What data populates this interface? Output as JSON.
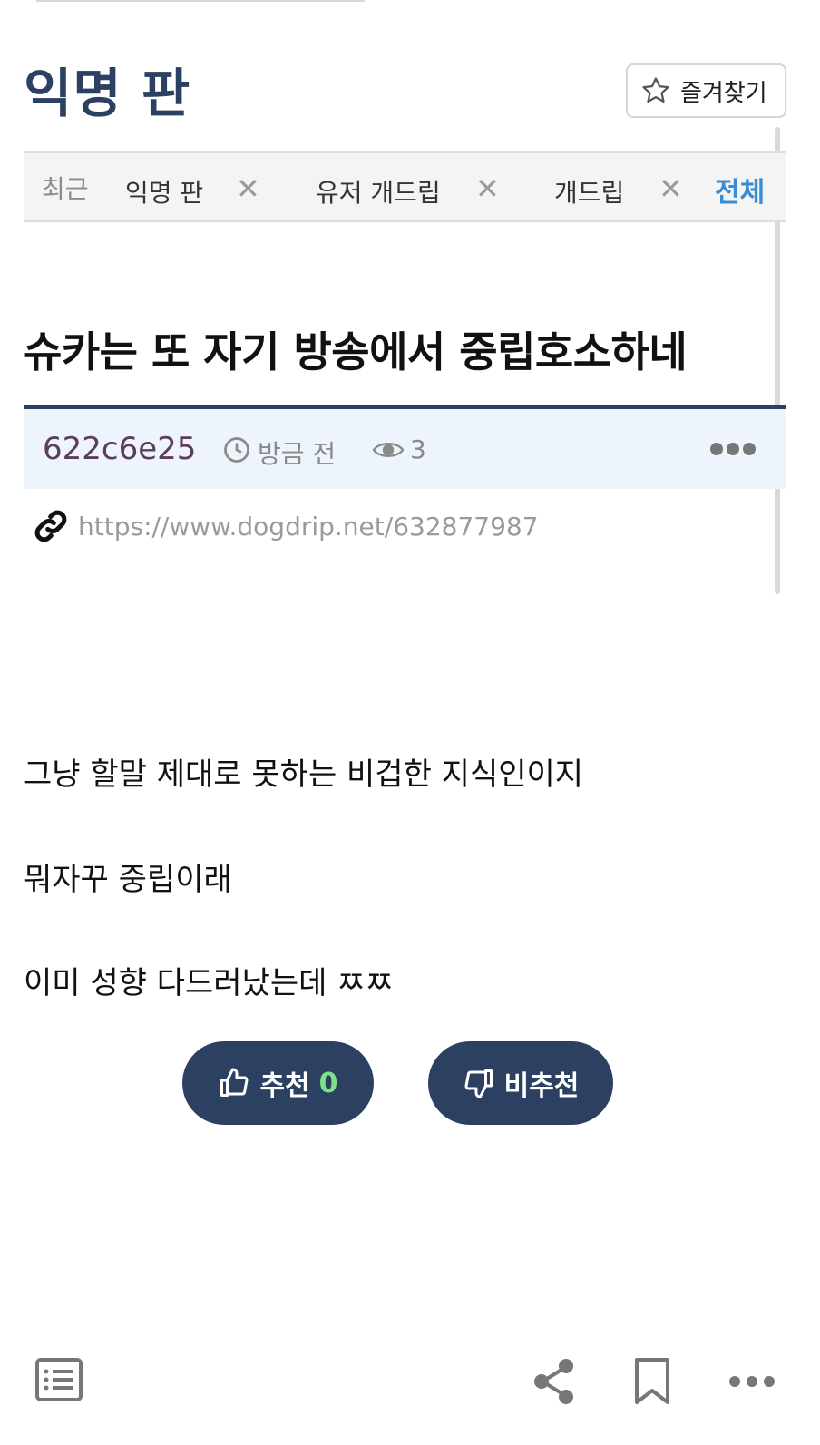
{
  "board": {
    "title": "익명 판"
  },
  "favorite": {
    "label": "즐겨찾기"
  },
  "recent": {
    "label": "최근",
    "items": [
      "익명 판",
      "유저 개드립",
      "개드립"
    ],
    "all_label": "전체"
  },
  "post": {
    "title": "슈카는 또 자기 방송에서 중립호소하네",
    "author": "622c6e25",
    "time": "방금 전",
    "views": "3",
    "url": "https://www.dogdrip.net/632877987",
    "body": [
      "그냥 할말 제대로 못하는 비겁한 지식인이지",
      "뭐자꾸 중립이래",
      "이미 성향 다드러났는데 ㅉㅉ"
    ]
  },
  "votes": {
    "up_label": "추천",
    "up_count": "0",
    "down_label": "비추천"
  },
  "colors": {
    "accent": "#2c4061",
    "link": "#3a8bd6",
    "author": "#5b3d5f",
    "up_count": "#7fe08a"
  }
}
